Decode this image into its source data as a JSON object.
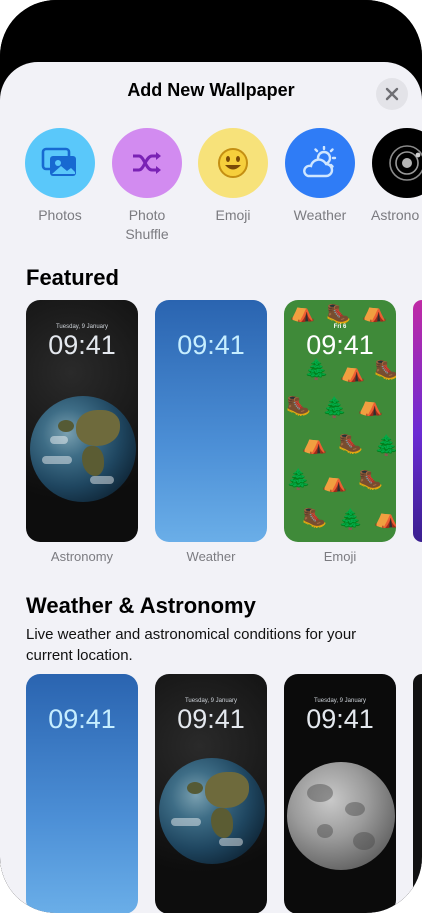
{
  "sheet": {
    "title": "Add New Wallpaper",
    "close_icon": "xmark-icon"
  },
  "types": [
    {
      "label": "Photos",
      "icon": "photos-icon",
      "color": "#5ac8fa"
    },
    {
      "label": "Photo\nShuffle",
      "icon": "shuffle-icon",
      "color": "#d28bf0"
    },
    {
      "label": "Emoji",
      "icon": "emoji-icon",
      "color": "#f7e27a"
    },
    {
      "label": "Weather",
      "icon": "weather-icon",
      "color": "#2f7cf6"
    },
    {
      "label": "Astrono",
      "icon": "astronomy-icon",
      "color": "#000000"
    }
  ],
  "featured": {
    "title": "Featured",
    "cards": [
      {
        "label": "Astronomy",
        "date": "Tuesday, 9 January",
        "time": "09:41"
      },
      {
        "label": "Weather",
        "time": "09:41"
      },
      {
        "label": "Emoji",
        "date": "Fri 6",
        "time": "09:41"
      }
    ]
  },
  "weather_astronomy": {
    "title": "Weather & Astronomy",
    "description": "Live weather and astronomical conditions for your current location.",
    "cards": [
      {
        "time": "09:41"
      },
      {
        "date": "Tuesday, 9 January",
        "time": "09:41"
      },
      {
        "date": "Tuesday, 9 January",
        "time": "09:41"
      }
    ]
  }
}
